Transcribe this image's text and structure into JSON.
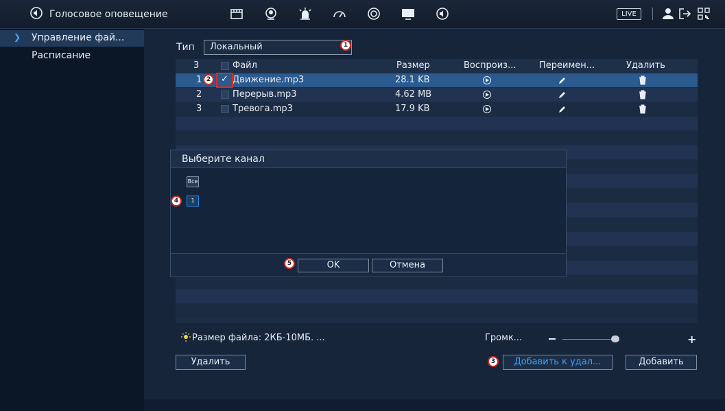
{
  "topbar": {
    "title": "Голосовое оповещение",
    "icons": [
      "speaker-icon",
      "film-icon",
      "face-icon",
      "alarm-icon",
      "gauge-icon",
      "sync-icon",
      "monitor-icon",
      "speaker-icon"
    ],
    "live_label": "LIVE",
    "right_icons": [
      "user-icon",
      "logout-icon",
      "qr-icon"
    ]
  },
  "sidebar": {
    "items": [
      {
        "label": "Управление фай...",
        "active": true
      },
      {
        "label": "Расписание",
        "active": false
      }
    ]
  },
  "type": {
    "label": "Тип",
    "value": "Локальный"
  },
  "table": {
    "headers": {
      "count": "3",
      "file": "Файл",
      "size": "Размер",
      "play": "Воспроиз...",
      "rename": "Переимен...",
      "delete": "Удалить"
    },
    "rows": [
      {
        "num": "1",
        "name": "Движение.mp3",
        "size": "28.1 KB",
        "checked": true
      },
      {
        "num": "2",
        "name": "Перерыв.mp3",
        "size": "4.62 MB",
        "checked": false
      },
      {
        "num": "3",
        "name": "Тревога.mp3",
        "size": "17.9 KB",
        "checked": false
      }
    ]
  },
  "modal": {
    "title": "Выберите канал",
    "all_label": "Все",
    "channel_label": "1",
    "ok_label": "OK",
    "cancel_label": "Отмена"
  },
  "footer": {
    "hint": "Размер файла: 2КБ-10МБ. ...",
    "volume_label": "Громк...",
    "delete_label": "Удалить",
    "add_to_label": "Добавить к удал...",
    "add_label": "Добавить"
  },
  "volume_level": 0.45,
  "badges": [
    "1",
    "2",
    "3",
    "4",
    "5"
  ],
  "colors": {
    "accent": "#3da0ff",
    "selected_row": "#2a5a8e",
    "annotation": "#d0281f"
  }
}
